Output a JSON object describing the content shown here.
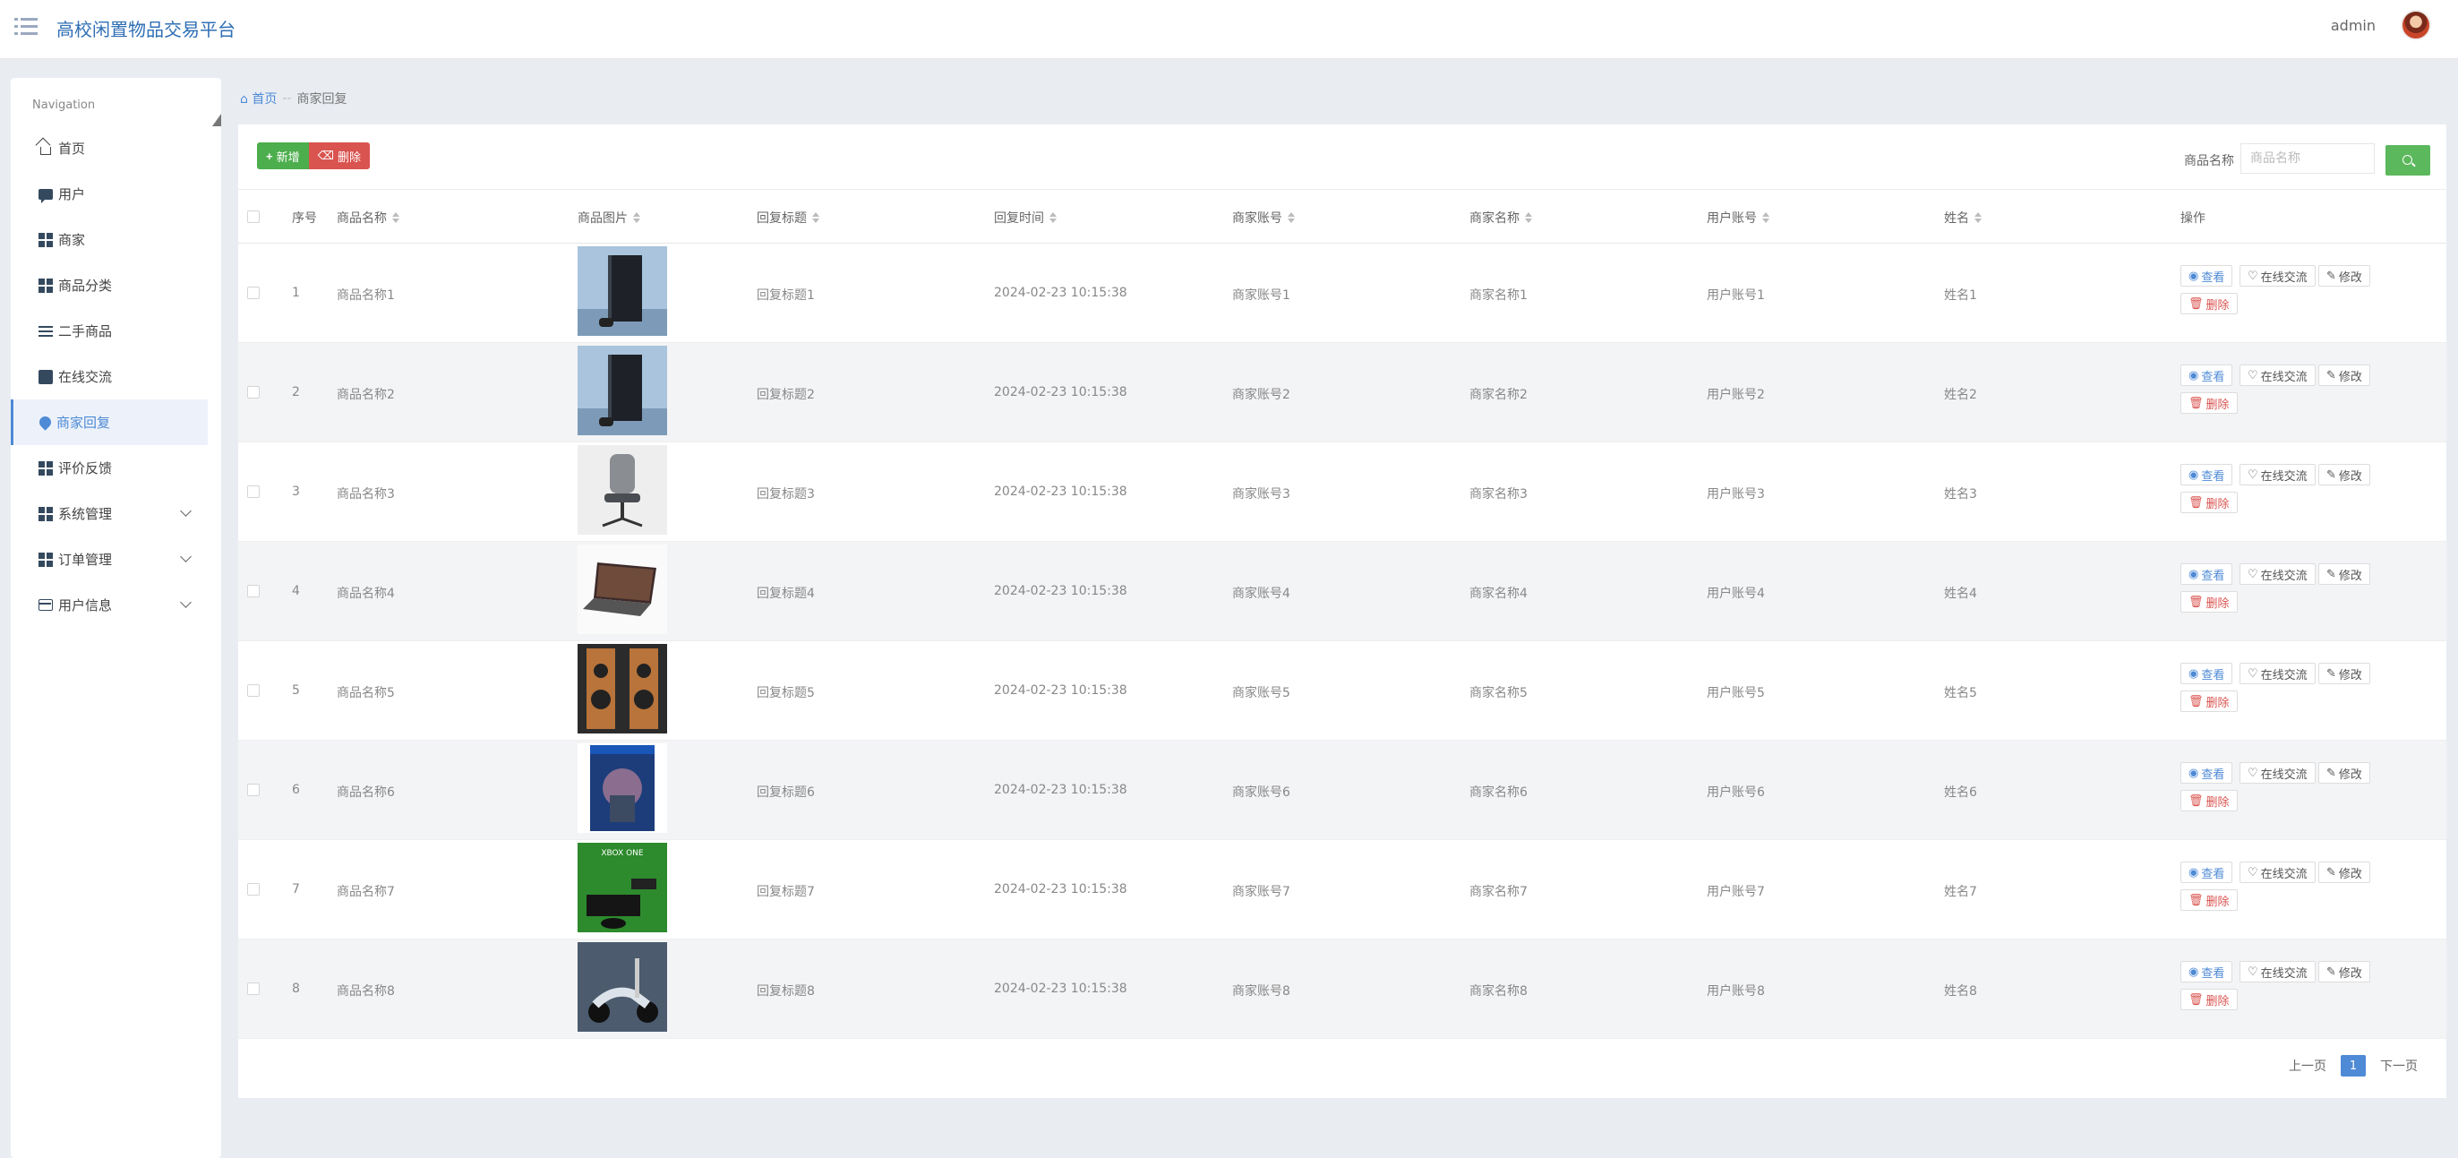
{
  "app": {
    "title": "高校闲置物品交易平台",
    "username": "admin"
  },
  "sidebar": {
    "title": "Navigation",
    "items": [
      {
        "label": "首页",
        "icon": "home-icon",
        "active": false
      },
      {
        "label": "用户",
        "icon": "chat-icon",
        "active": false
      },
      {
        "label": "商家",
        "icon": "grid-icon",
        "active": false
      },
      {
        "label": "商品分类",
        "icon": "grid-icon",
        "active": false
      },
      {
        "label": "二手商品",
        "icon": "sliders-icon",
        "active": false
      },
      {
        "label": "在线交流",
        "icon": "inbox-icon",
        "active": false
      },
      {
        "label": "商家回复",
        "icon": "pin-icon",
        "active": true
      },
      {
        "label": "评价反馈",
        "icon": "grid-icon",
        "active": false
      },
      {
        "label": "系统管理",
        "icon": "grid-icon",
        "active": false,
        "expandable": true
      },
      {
        "label": "订单管理",
        "icon": "grid-icon",
        "active": false,
        "expandable": true
      },
      {
        "label": "用户信息",
        "icon": "card-icon",
        "active": false,
        "expandable": true
      }
    ]
  },
  "breadcrumb": {
    "home": "首页",
    "separator": "--",
    "current": "商家回复"
  },
  "toolbar": {
    "add_label": "新增",
    "delete_label": "删除"
  },
  "search": {
    "label": "商品名称",
    "placeholder": "商品名称"
  },
  "table": {
    "headers": {
      "index": "序号",
      "name": "商品名称",
      "image": "商品图片",
      "reply_title": "回复标题",
      "reply_time": "回复时间",
      "merchant_account": "商家账号",
      "merchant_name": "商家名称",
      "user_account": "用户账号",
      "real_name": "姓名",
      "actions": "操作"
    },
    "actions": {
      "view": "查看",
      "chat": "在线交流",
      "edit": "修改",
      "delete": "删除"
    },
    "rows": [
      {
        "index": "1",
        "name": "商品名称1",
        "reply_title": "回复标题1",
        "reply_time": "2024-02-23 10:15:38",
        "merchant_account": "商家账号1",
        "merchant_name": "商家名称1",
        "user_account": "用户账号1",
        "real_name": "姓名1",
        "image": "game-console-tower"
      },
      {
        "index": "2",
        "name": "商品名称2",
        "reply_title": "回复标题2",
        "reply_time": "2024-02-23 10:15:38",
        "merchant_account": "商家账号2",
        "merchant_name": "商家名称2",
        "user_account": "用户账号2",
        "real_name": "姓名2",
        "image": "game-console-tower"
      },
      {
        "index": "3",
        "name": "商品名称3",
        "reply_title": "回复标题3",
        "reply_time": "2024-02-23 10:15:38",
        "merchant_account": "商家账号3",
        "merchant_name": "商家名称3",
        "user_account": "用户账号3",
        "real_name": "姓名3",
        "image": "office-chair"
      },
      {
        "index": "4",
        "name": "商品名称4",
        "reply_title": "回复标题4",
        "reply_time": "2024-02-23 10:15:38",
        "merchant_account": "商家账号4",
        "merchant_name": "商家名称4",
        "user_account": "用户账号4",
        "real_name": "姓名4",
        "image": "laptop"
      },
      {
        "index": "5",
        "name": "商品名称5",
        "reply_title": "回复标题5",
        "reply_time": "2024-02-23 10:15:38",
        "merchant_account": "商家账号5",
        "merchant_name": "商家名称5",
        "user_account": "用户账号5",
        "real_name": "姓名5",
        "image": "speakers"
      },
      {
        "index": "6",
        "name": "商品名称6",
        "reply_title": "回复标题6",
        "reply_time": "2024-02-23 10:15:38",
        "merchant_account": "商家账号6",
        "merchant_name": "商家名称6",
        "user_account": "用户账号6",
        "real_name": "姓名6",
        "image": "game-box"
      },
      {
        "index": "7",
        "name": "商品名称7",
        "reply_title": "回复标题7",
        "reply_time": "2024-02-23 10:15:38",
        "merchant_account": "商家账号7",
        "merchant_name": "商家名称7",
        "user_account": "用户账号7",
        "real_name": "姓名7",
        "image": "xbox-box"
      },
      {
        "index": "8",
        "name": "商品名称8",
        "reply_title": "回复标题8",
        "reply_time": "2024-02-23 10:15:38",
        "merchant_account": "商家账号8",
        "merchant_name": "商家名称8",
        "user_account": "用户账号8",
        "real_name": "姓名8",
        "image": "scooter"
      }
    ]
  },
  "pagination": {
    "prev": "上一页",
    "current": "1",
    "next": "下一页"
  },
  "colors": {
    "brand": "#2f6fb5",
    "accent": "#4e8ad6",
    "add": "#4cae4c",
    "danger": "#d9534f",
    "search": "#5cb85c"
  }
}
